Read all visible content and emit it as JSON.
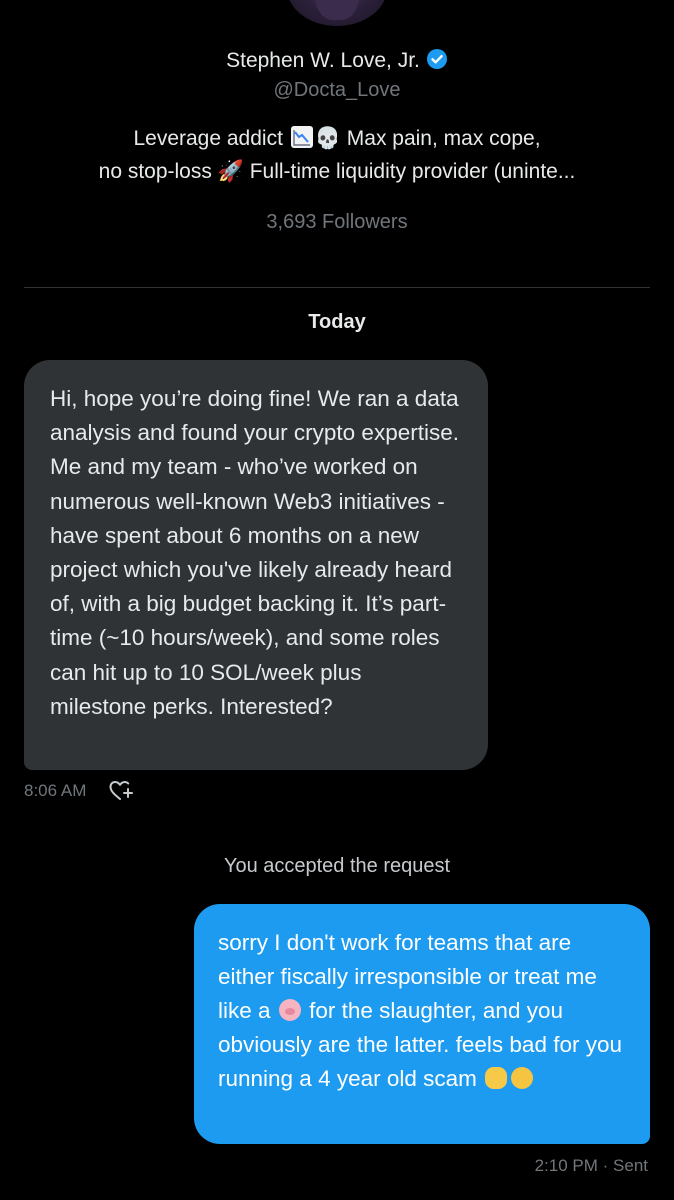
{
  "profile": {
    "name": "Stephen W. Love, Jr.",
    "handle": "@Docta_Love",
    "bio_line1_a": "Leverage addict",
    "bio_line1_skull": "💀",
    "bio_line1_b": "Max pain, max cope,",
    "bio_line2_a": "no stop-loss",
    "bio_line2_rocket": "🚀",
    "bio_line2_b": "Full-time liquidity provider (uninte...",
    "followers": "3,693 Followers",
    "verified_color": "#1d9bf0"
  },
  "conversation": {
    "date_label": "Today",
    "incoming": {
      "text": "Hi, hope you’re doing fine! We ran a data analysis and found your crypto expertise. Me and my team - who’ve worked on numerous well-known Web3 initiatives - have spent about 6 months on a new project which you've likely already heard of, with a big budget backing it. It’s part-time (~10 hours/week), and some roles can hit up to 10 SOL/week plus milestone perks. Interested?",
      "time": "8:06 AM",
      "bubble_color": "#2f3336"
    },
    "system_note": "You accepted the request",
    "outgoing": {
      "text_a": "sorry I don't work for teams that are either fiscally irresponsible or treat me like a",
      "text_b": "for the slaughter, and you obviously are the latter. feels bad for you running a 4 year old scam",
      "emoji_pig": "🐷",
      "emoji_fist": "👊",
      "emoji_cat": "😹",
      "meta": "2:10 PM · Sent",
      "bubble_color": "#1d9bf0"
    }
  },
  "icons": {
    "verified": "verified-badge-icon",
    "react": "add-reaction-icon",
    "chart": "chart-decreasing-icon"
  }
}
